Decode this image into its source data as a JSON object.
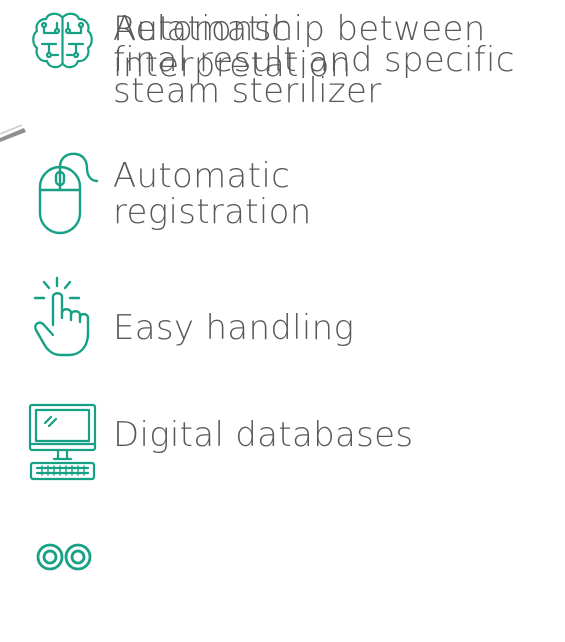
{
  "accent_color": "#16a085",
  "text_color": "#59595b",
  "features": [
    {
      "icon": "brain-circuit-icon",
      "label_line1": "Automatic",
      "label_line2": "interpretation"
    },
    {
      "icon": "computer-mouse-icon",
      "label_line1": "Automatic",
      "label_line2": "registration"
    },
    {
      "icon": "hand-tap-icon",
      "label_line1": "Easy handling"
    },
    {
      "icon": "desktop-computer-icon",
      "label_line1": "Digital databases"
    },
    {
      "icon": "infinity-link-icon",
      "label_line1": "Relationship between",
      "label_line2": "final result and specific",
      "label_line3": "steam sterilizer"
    }
  ]
}
